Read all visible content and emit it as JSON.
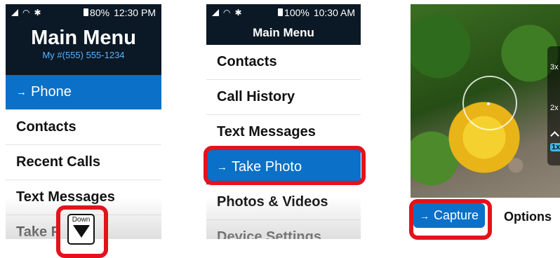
{
  "screen1": {
    "status": {
      "battery": "80%",
      "time": "12:30 PM"
    },
    "header": {
      "title": "Main Menu",
      "subtitle": "My #(555) 555-1234"
    },
    "items": [
      {
        "label": "Phone",
        "selected": true
      },
      {
        "label": "Contacts"
      },
      {
        "label": "Recent Calls"
      },
      {
        "label": "Text Messages"
      },
      {
        "label": "Take P"
      }
    ],
    "down_key": {
      "label": "Down"
    }
  },
  "screen2": {
    "status": {
      "battery": "100%",
      "time": "10:30 AM"
    },
    "header": {
      "title": "Main Menu"
    },
    "items": [
      {
        "label": "Contacts"
      },
      {
        "label": "Call History"
      },
      {
        "label": "Text Messages"
      },
      {
        "label": "Take Photo",
        "selected": true
      },
      {
        "label": "Photos & Videos"
      },
      {
        "label": "Device Settings"
      }
    ]
  },
  "screen3": {
    "zoom_levels": [
      "3x",
      "2x",
      "1x"
    ],
    "active_zoom": "1x",
    "buttons": {
      "capture": "Capture",
      "options": "Options"
    }
  },
  "arrow_glyph": "→",
  "colors": {
    "accent": "#0a70c8",
    "header": "#0b1825",
    "callout": "#e4121c",
    "subtitle": "#5ab3ff"
  }
}
